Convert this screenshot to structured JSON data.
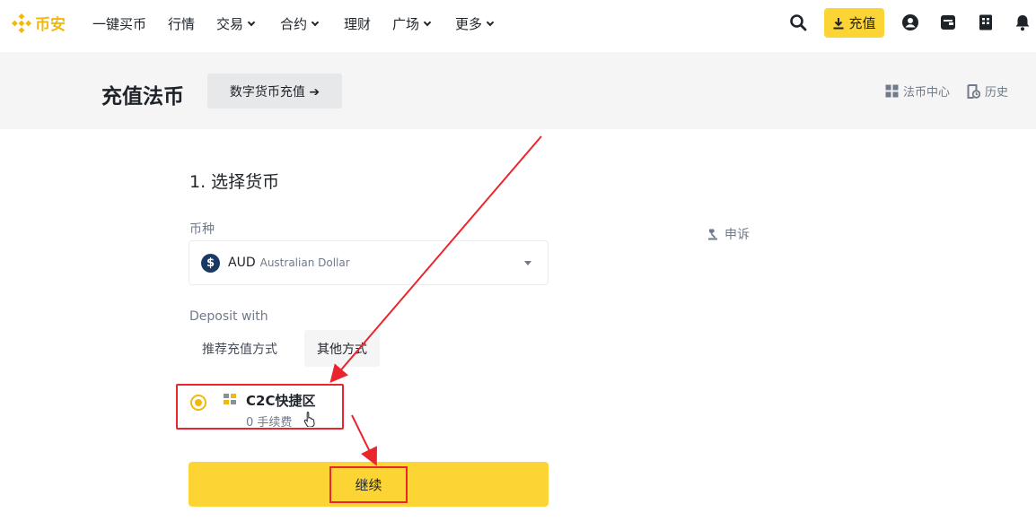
{
  "brand": {
    "logo_text": "币安",
    "accent": "#F0B90B",
    "button_yellow": "#FCD535",
    "annotation_red": "#E9262E"
  },
  "nav": {
    "items": [
      {
        "label": "一键买币",
        "has_caret": false
      },
      {
        "label": "行情",
        "has_caret": false
      },
      {
        "label": "交易",
        "has_caret": true
      },
      {
        "label": "合约",
        "has_caret": true
      },
      {
        "label": "理财",
        "has_caret": false
      },
      {
        "label": "广场",
        "has_caret": true
      },
      {
        "label": "更多",
        "has_caret": true
      }
    ],
    "deposit_label": "充值",
    "icons": [
      "search-icon",
      "download-icon",
      "user-icon",
      "wallet-icon",
      "orders-icon",
      "bell-icon"
    ]
  },
  "header": {
    "title": "充值法币",
    "crypto_button": "数字货币充值 ➔",
    "fiat_center": "法币中心",
    "history": "历史"
  },
  "form": {
    "step_title": "1. 选择货币",
    "currency_label": "币种",
    "currency_code": "AUD",
    "currency_name": "Australian Dollar",
    "currency_symbol": "$",
    "deposit_with_label": "Deposit with",
    "tabs": [
      {
        "label": "推荐充值方式",
        "active": false
      },
      {
        "label": "其他方式",
        "active": true
      }
    ],
    "option": {
      "title": "C2C快捷区",
      "fee": "0 手续费",
      "selected": true
    },
    "continue_label": "继续"
  },
  "side": {
    "appeal": "申诉"
  }
}
